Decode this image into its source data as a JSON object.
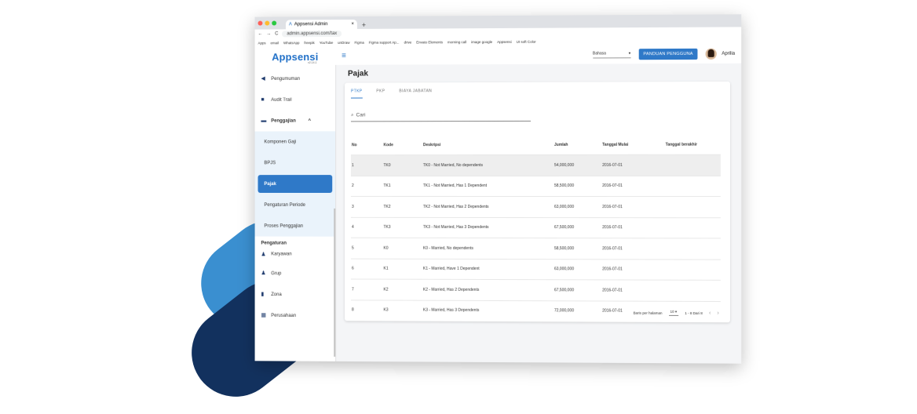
{
  "browser": {
    "tab_title": "Appsensi Admin",
    "url": "admin.appsensi.com/tax",
    "bookmarks": [
      "Apps",
      "email",
      "WhatsApp",
      "freepik",
      "YouTube",
      "unDraw",
      "Figma",
      "Figma support Ap...",
      "drive",
      "Envato Elements",
      "morning call",
      "image google",
      "Appsensi",
      "UI soft Color"
    ]
  },
  "app": {
    "logo": "Appsensi",
    "version": "v2.14.1",
    "language": "Bahasa",
    "guide_button": "PANDUAN PENGGUNA",
    "user_name": "Aprilia",
    "accent": "#2f79c8"
  },
  "sidebar": {
    "items": [
      {
        "label": "Pengumuman",
        "icon": "megaphone-icon"
      },
      {
        "label": "Audit Trail",
        "icon": "audit-icon"
      },
      {
        "label": "Penggajian",
        "icon": "payroll-icon"
      }
    ],
    "sub_items": [
      "Komponen Gaji",
      "BPJS",
      "Pajak",
      "Pengaturan Periode",
      "Proses Penggajian"
    ],
    "active_sub": "Pajak",
    "section_label": "Pengaturan",
    "settings_items": [
      {
        "label": "Karyawan",
        "icon": "employees-icon"
      },
      {
        "label": "Grup",
        "icon": "group-icon"
      },
      {
        "label": "Zona",
        "icon": "zone-icon"
      },
      {
        "label": "Perusahaan",
        "icon": "company-icon"
      }
    ]
  },
  "page": {
    "title": "Pajak",
    "tabs": [
      "PTKP",
      "PKP",
      "BIAYA JABATAN"
    ],
    "active_tab": "PTKP",
    "search_placeholder": "Cari"
  },
  "table": {
    "columns": [
      "No",
      "Kode",
      "Deskripsi",
      "Jumlah",
      "Tanggal Mulai",
      "Tanggal berakhir"
    ],
    "rows": [
      [
        "1",
        "TK0",
        "TK0 - Not Married, No dependents",
        "54,000,000",
        "2016-07-01",
        ""
      ],
      [
        "2",
        "TK1",
        "TK1 - Not Married, Has 1 Dependent",
        "58,500,000",
        "2016-07-01",
        ""
      ],
      [
        "3",
        "TK2",
        "TK2 - Not Married, Has 2 Dependents",
        "63,000,000",
        "2016-07-01",
        ""
      ],
      [
        "4",
        "TK3",
        "TK3 - Not Married, Has 3 Dependents",
        "67,500,000",
        "2016-07-01",
        ""
      ],
      [
        "5",
        "K0",
        "K0 - Married, No dependents",
        "58,500,000",
        "2016-07-01",
        ""
      ],
      [
        "6",
        "K1",
        "K1 - Married, Have 1 Dependent",
        "63,000,000",
        "2016-07-01",
        ""
      ],
      [
        "7",
        "K2",
        "K2 - Married, Has 2 Dependents",
        "67,500,000",
        "2016-07-01",
        ""
      ],
      [
        "8",
        "K3",
        "K3 - Married, Has 3 Dependents",
        "72,000,000",
        "2016-07-01",
        ""
      ]
    ]
  },
  "pagination": {
    "rows_per_page_label": "Baris per halaman",
    "rows_per_page": "10",
    "range": "1 - 8 Dari 8"
  }
}
